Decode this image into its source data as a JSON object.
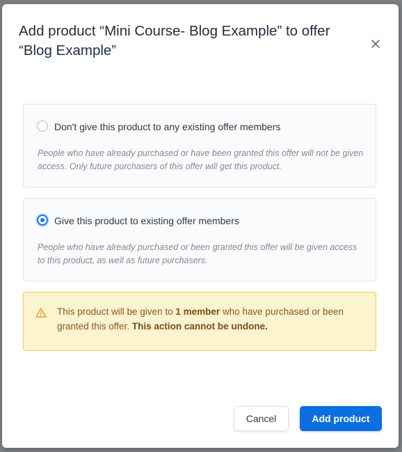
{
  "modal": {
    "title": "Add product “Mini Course- Blog Example” to offer “Blog Example”",
    "close_icon": "close-icon"
  },
  "options": [
    {
      "label": "Don't give this product to any existing offer members",
      "description": "People who have already purchased or have been granted this offer will not be given access. Only future purchasers of this offer will get this product.",
      "selected": false
    },
    {
      "label": "Give this product to existing offer members",
      "description": "People who have already purchased or been granted this offer will be given access to this product, as well as future purchasers.",
      "selected": true
    }
  ],
  "warning": {
    "icon": "warning-triangle-icon",
    "text_before": "This product will be given to ",
    "member_count": "1 member",
    "text_middle": " who have purchased or been granted this offer. ",
    "emphasis": "This action cannot be undone."
  },
  "footer": {
    "cancel_label": "Cancel",
    "add_label": "Add product"
  },
  "colors": {
    "accent": "#0b6fe0",
    "warning_bg": "#fcf3cf",
    "warning_border": "#f2c94c",
    "warning_text": "#8a5a1f"
  }
}
